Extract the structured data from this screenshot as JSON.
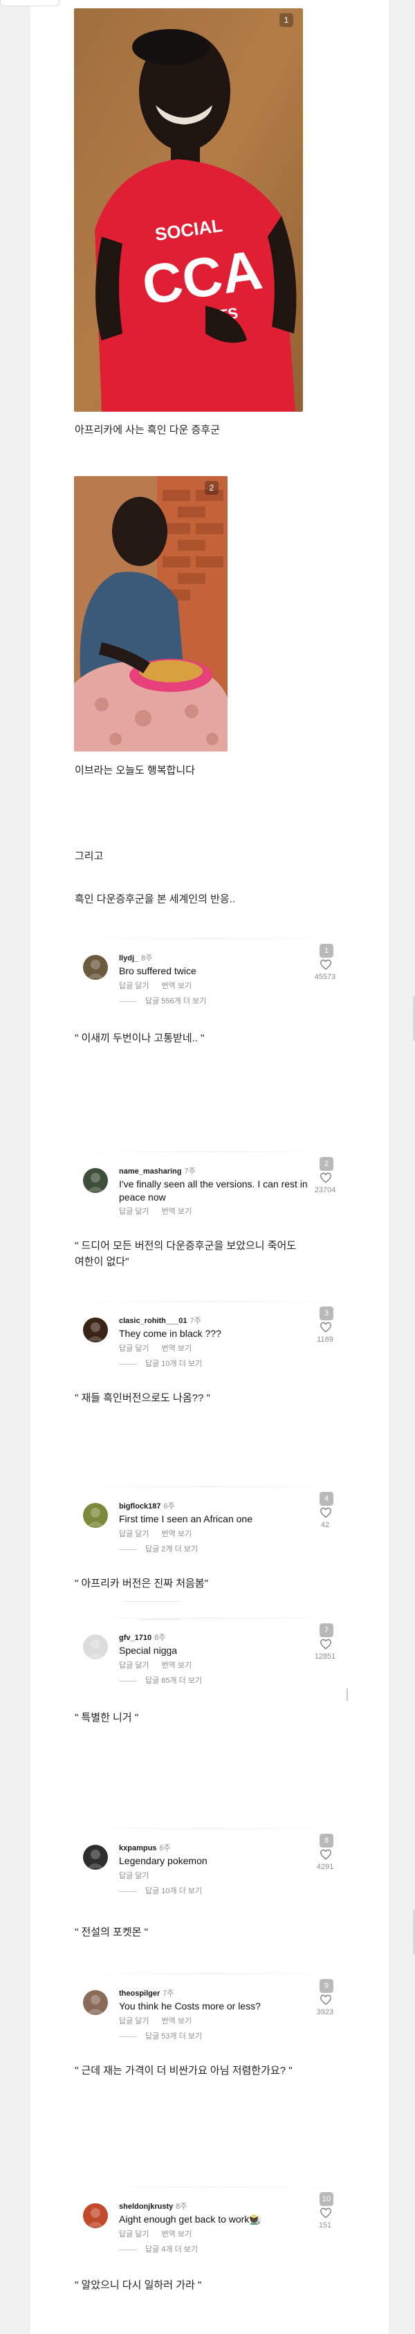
{
  "photos": [
    {
      "index": "1",
      "caption": "아프리카에 사는 흑인 다운 증후군"
    },
    {
      "index": "2",
      "caption": "이브라는 오늘도 행복합니다"
    }
  ],
  "print_labels": {
    "social": "SOCIAL",
    "cca": "CCA",
    "ts": "TS"
  },
  "text_lines": [
    "그리고",
    "흑인 다운증후군을 본 세계인의 반응.."
  ],
  "comments": [
    {
      "number": "1",
      "user": "llydj_",
      "time": "8주",
      "text": "Bro suffered twice",
      "actions": [
        "답글 달기",
        "번역 보기"
      ],
      "more": "답글 556개 더 보기",
      "likes": "45573",
      "quote": "\" 이새끼 두번이나 고통받네.. \"",
      "avatar_color": "#6b5a3e"
    },
    {
      "number": "2",
      "user": "name_masharing",
      "time": "7주",
      "text": "I've finally seen all the versions. I can rest in peace now",
      "actions": [
        "답글 달기",
        "번역 보기"
      ],
      "more": "",
      "likes": "23704",
      "quote": "\" 드디어 모든 버전의 다운증후군을 보았으니 죽어도 여한이 없다\"",
      "avatar_color": "#3f4e3a"
    },
    {
      "number": "3",
      "user": "clasic_rohith___01",
      "time": "7주",
      "text": "They come in black ???",
      "actions": [
        "답글 달기",
        "번역 보기"
      ],
      "more": "답글 10개 더 보기",
      "likes": "1169",
      "quote": "\" 재들 흑인버전으로도 나옴?? \"",
      "avatar_color": "#3a2418"
    },
    {
      "number": "4",
      "user": "bigflock187",
      "time": "6주",
      "text": "First time I seen an African one",
      "actions": [
        "답글 달기",
        "번역 보기"
      ],
      "more": "답글 2개 더 보기",
      "likes": "42",
      "quote": "\" 아프리카 버전은 진짜 처음봄\"",
      "avatar_color": "#7a8a3a"
    },
    {
      "number": "7",
      "user": "gfv_1710",
      "time": "8주",
      "text": "Special nigga",
      "actions": [
        "답글 달기",
        "번역 보기"
      ],
      "more": "답글 65개 더 보기",
      "likes": "12851",
      "quote": "\" 특별한 니거 \"",
      "avatar_color": "#dcdcdc"
    },
    {
      "number": "8",
      "user": "kxpampus",
      "time": "6주",
      "text": "Legendary pokemon",
      "actions": [
        "답글 달기"
      ],
      "more": "답글 10개 더 보기",
      "likes": "4291",
      "quote": "\" 전설의 포켓몬 \"",
      "avatar_color": "#2e2e2e"
    },
    {
      "number": "9",
      "user": "theospilger",
      "time": "7주",
      "text": "You think he Costs more or less?",
      "actions": [
        "답글 달기",
        "번역 보기"
      ],
      "more": "답글 53개 더 보기",
      "likes": "3923",
      "quote": "\" 근데 재는 가격이 더 비싼가요 아님 저렴한가요? \"",
      "avatar_color": "#8a6a58"
    },
    {
      "number": "10",
      "user": "sheldonjkrusty",
      "time": "8주",
      "text": "Aight enough get back to work🧑🏿‍🌾",
      "actions": [
        "답글 달기",
        "번역 보기"
      ],
      "more": "답글 4개 더 보기",
      "likes": "151",
      "quote": "\" 알았으니 다시 일하러 가라 \"",
      "avatar_color": "#c04a2a"
    }
  ]
}
